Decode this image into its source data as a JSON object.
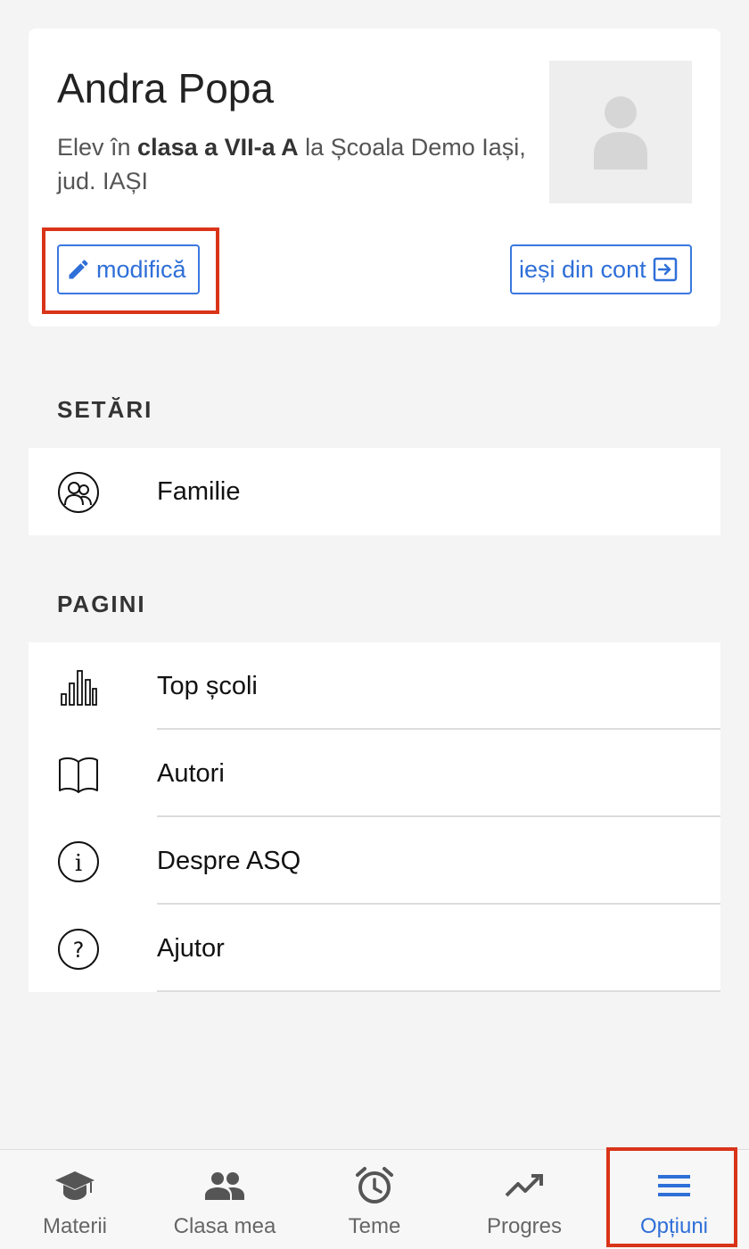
{
  "profile": {
    "name": "Andra Popa",
    "desc_prefix": "Elev în ",
    "desc_class": "clasa a VII-a A",
    "desc_suffix": " la Școala Demo Iași, jud. IAȘI",
    "edit_label": "modifică",
    "logout_label": "ieși din cont"
  },
  "settings": {
    "title": "SETĂRI",
    "items": [
      {
        "label": "Familie",
        "icon": "family-icon"
      }
    ]
  },
  "pages": {
    "title": "PAGINI",
    "items": [
      {
        "label": "Top școli",
        "icon": "bar-chart-icon"
      },
      {
        "label": "Autori",
        "icon": "book-icon"
      },
      {
        "label": "Despre ASQ",
        "icon": "info-icon"
      },
      {
        "label": "Ajutor",
        "icon": "help-icon"
      }
    ]
  },
  "tabs": [
    {
      "label": "Materii",
      "icon": "graduation-cap-icon",
      "active": false
    },
    {
      "label": "Clasa mea",
      "icon": "people-icon",
      "active": false
    },
    {
      "label": "Teme",
      "icon": "alarm-clock-icon",
      "active": false
    },
    {
      "label": "Progres",
      "icon": "trending-up-icon",
      "active": false
    },
    {
      "label": "Opțiuni",
      "icon": "menu-icon",
      "active": true
    }
  ],
  "colors": {
    "accent": "#2f6fd8",
    "highlight": "#d93419"
  }
}
